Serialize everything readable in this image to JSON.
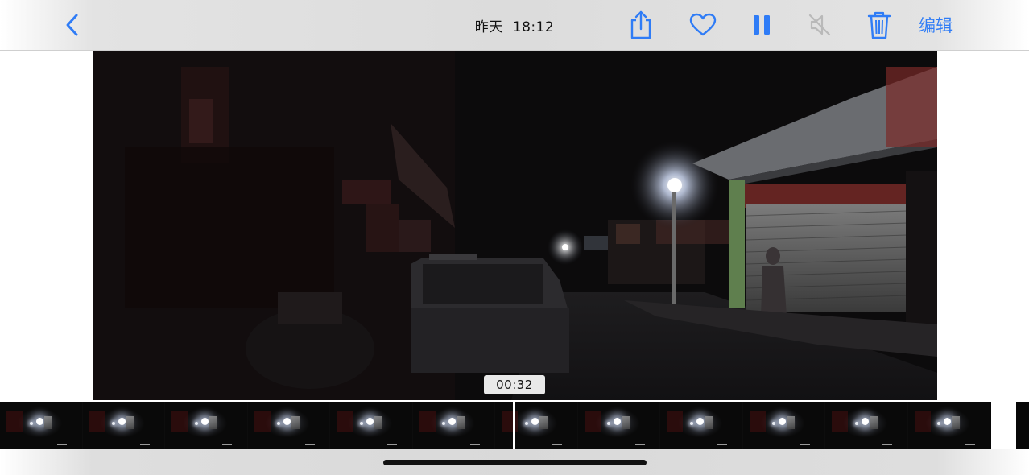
{
  "header": {
    "date_label": "昨天",
    "time_label": "18:12",
    "edit_label": "编辑"
  },
  "icons": {
    "back": "chevron-left-icon",
    "share": "share-icon",
    "favorite": "heart-icon",
    "pause": "pause-icon",
    "mute": "speaker-muted-icon",
    "delete": "trash-icon"
  },
  "video": {
    "current_time": "00:32"
  },
  "filmstrip": {
    "frame_count": 12
  },
  "colors": {
    "accent": "#2f7cf6",
    "muted_icon": "#b9b9b9"
  }
}
